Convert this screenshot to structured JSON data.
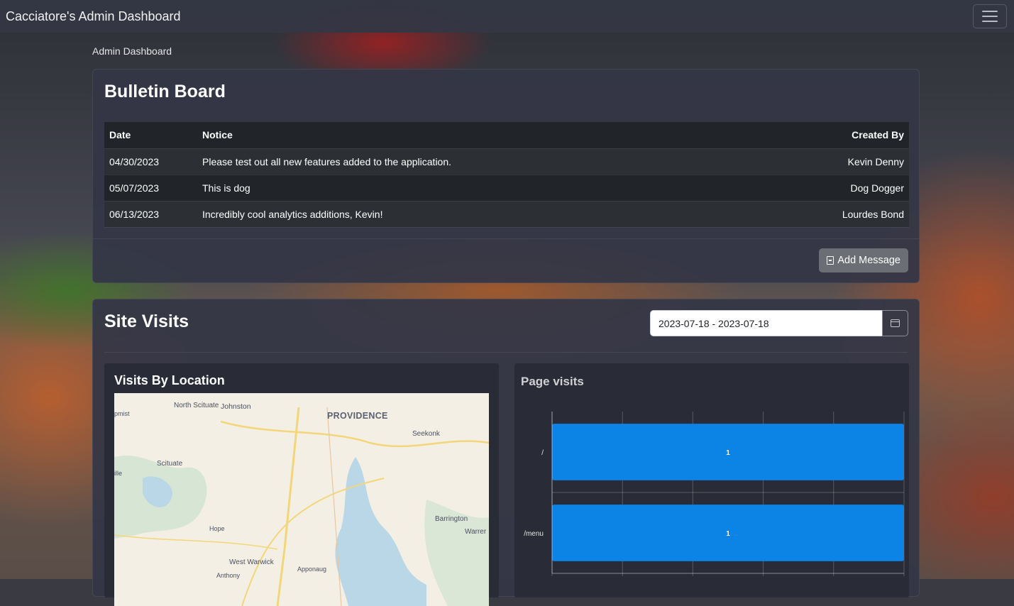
{
  "app": {
    "title": "Cacciatore's Admin Dashboard"
  },
  "breadcrumb": "Admin Dashboard",
  "bulletin": {
    "title": "Bulletin Board",
    "headers": {
      "date": "Date",
      "notice": "Notice",
      "created_by": "Created By"
    },
    "rows": [
      {
        "date": "04/30/2023",
        "notice": "Please test out all new features added to the application.",
        "created_by": "Kevin Denny"
      },
      {
        "date": "05/07/2023",
        "notice": "This is dog",
        "created_by": "Dog Dogger"
      },
      {
        "date": "06/13/2023",
        "notice": "Incredibly cool analytics additions, Kevin!",
        "created_by": "Lourdes Bond"
      }
    ],
    "add_button": "Add Message"
  },
  "site_visits": {
    "title": "Site Visits",
    "date_range": "2023-07-18 - 2023-07-18",
    "location_panel": {
      "title": "Visits By Location",
      "labels": [
        "North Scituate",
        "Johnston",
        "PROVIDENCE",
        "Seekonk",
        "Scituate",
        "Barrington",
        "Warrer",
        "Hope",
        "West Warwick",
        "Apponaug",
        "Anthony",
        "pmist",
        "ille"
      ]
    },
    "page_panel": {
      "title": "Page visits"
    }
  },
  "chart_data": {
    "type": "bar",
    "orientation": "horizontal",
    "title": "Page visits",
    "categories": [
      "/",
      "/menu"
    ],
    "values": [
      1,
      1
    ],
    "bar_color": "#0b84e6",
    "grid": true
  },
  "colors": {
    "accent": "#0b84e6",
    "navbar": "#343644",
    "table_header": "#212529"
  }
}
